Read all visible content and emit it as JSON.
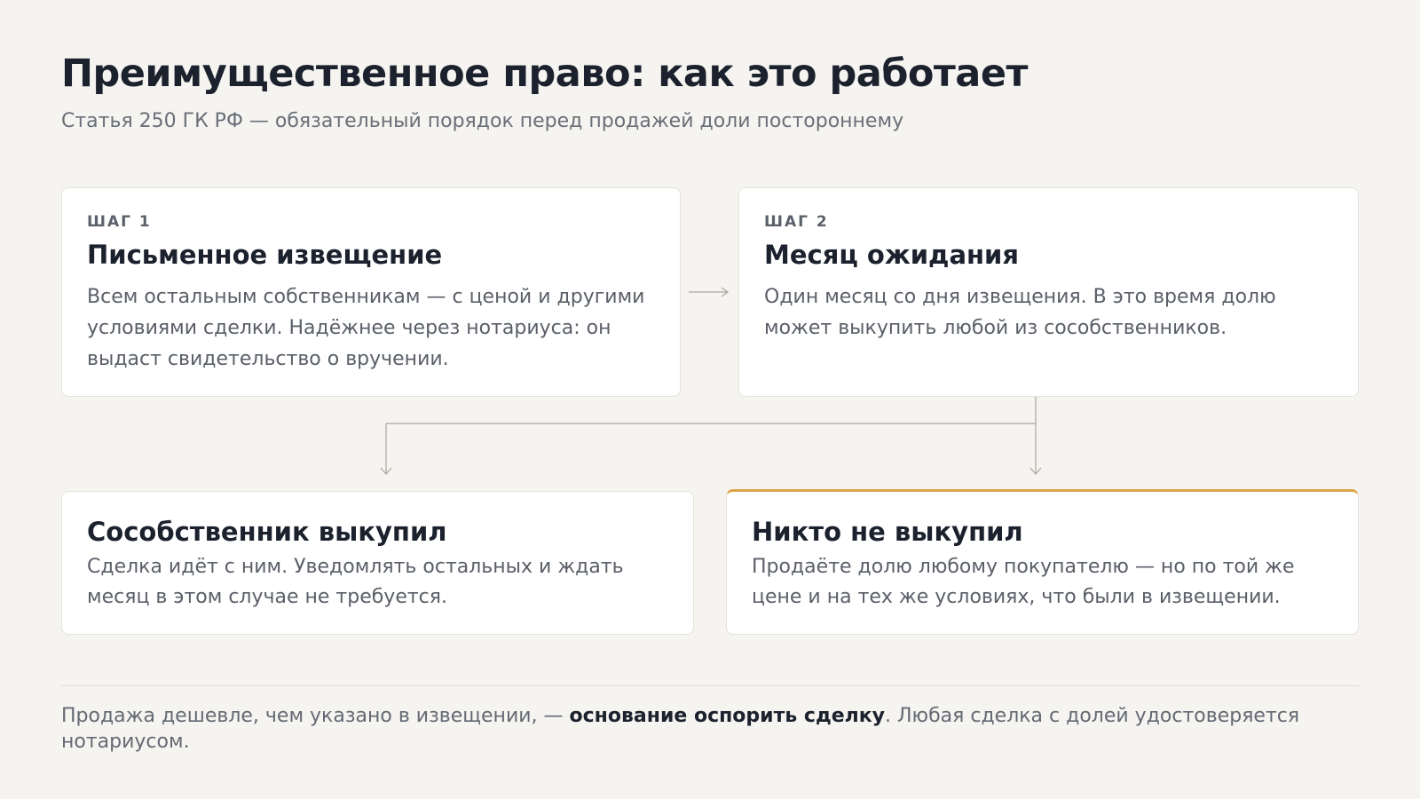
{
  "header": {
    "title": "Преимущественное право: как это работает",
    "subtitle": "Статья 250 ГК РФ — обязательный порядок перед продажей доли постороннему"
  },
  "steps": [
    {
      "label": "ШАГ 1",
      "title": "Письменное извещение",
      "text": "Всем остальным собственникам — с ценой и другими условиями сделки. Надёжнее через нотариуса: он выдаст свидетельство о вручении."
    },
    {
      "label": "ШАГ 2",
      "title": "Месяц ожидания",
      "text": "Один месяц со дня извещения. В это время долю может выкупить любой из сособственников."
    }
  ],
  "outcomes": [
    {
      "title": "Сособственник выкупил",
      "text": "Сделка идёт с ним. Уведомлять остальных и ждать месяц в этом случае не требуется."
    },
    {
      "title": "Никто не выкупил",
      "text": "Продаёте долю любому покупателю — но по той же цене и на тех же условиях, что были в извещении."
    }
  ],
  "footer": {
    "prefix": "Продажа дешевле, чем указано в извещении, — ",
    "emphasis": "основание оспорить сделку",
    "suffix": ". Любая сделка с долей удостоверяется нотариусом."
  },
  "colors": {
    "background": "#f5f4f0",
    "accent": "#dca448",
    "connector": "#a9a69e"
  }
}
